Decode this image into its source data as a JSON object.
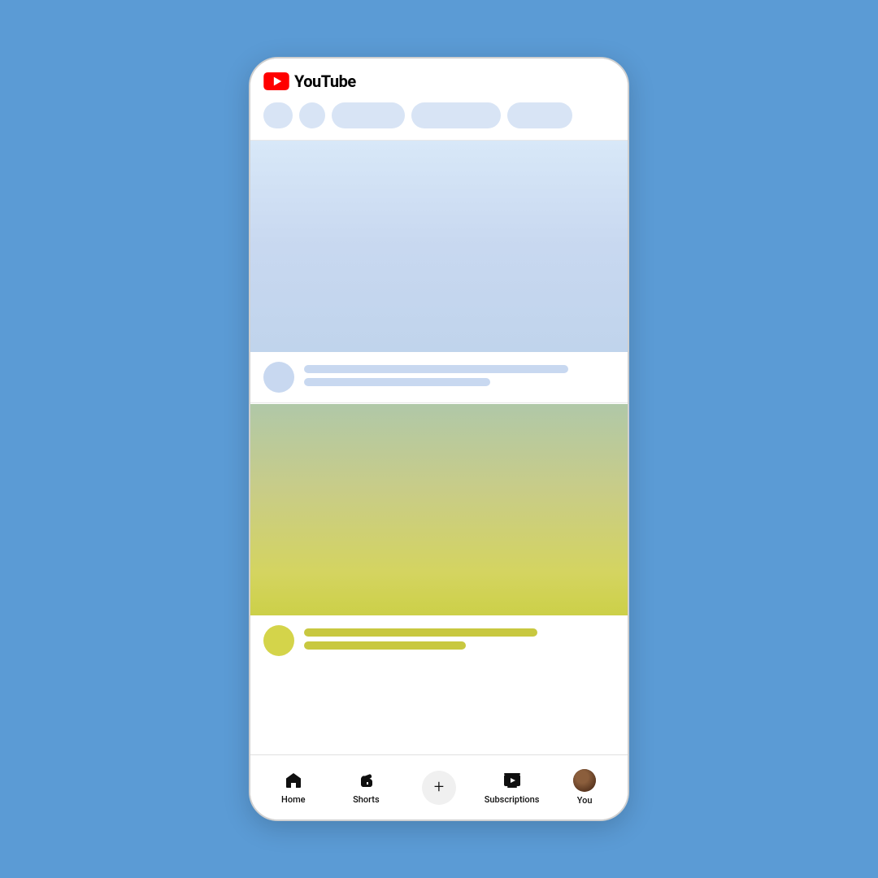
{
  "app": {
    "name": "YouTube",
    "logo_text": "YouTube"
  },
  "header": {
    "chips": [
      {
        "type": "square",
        "label": ""
      },
      {
        "type": "circle",
        "label": ""
      },
      {
        "type": "pill-md",
        "label": ""
      },
      {
        "type": "pill-lg",
        "label": ""
      },
      {
        "type": "pill-xl",
        "label": ""
      }
    ]
  },
  "content": {
    "video1": {
      "thumbnail_alt": "Loading video thumbnail"
    },
    "video2": {
      "thumbnail_alt": "Loading video thumbnail with gradient"
    }
  },
  "bottom_nav": {
    "items": [
      {
        "id": "home",
        "label": "Home"
      },
      {
        "id": "shorts",
        "label": "Shorts"
      },
      {
        "id": "add",
        "label": ""
      },
      {
        "id": "subscriptions",
        "label": "Subscriptions"
      },
      {
        "id": "you",
        "label": "You"
      }
    ]
  }
}
